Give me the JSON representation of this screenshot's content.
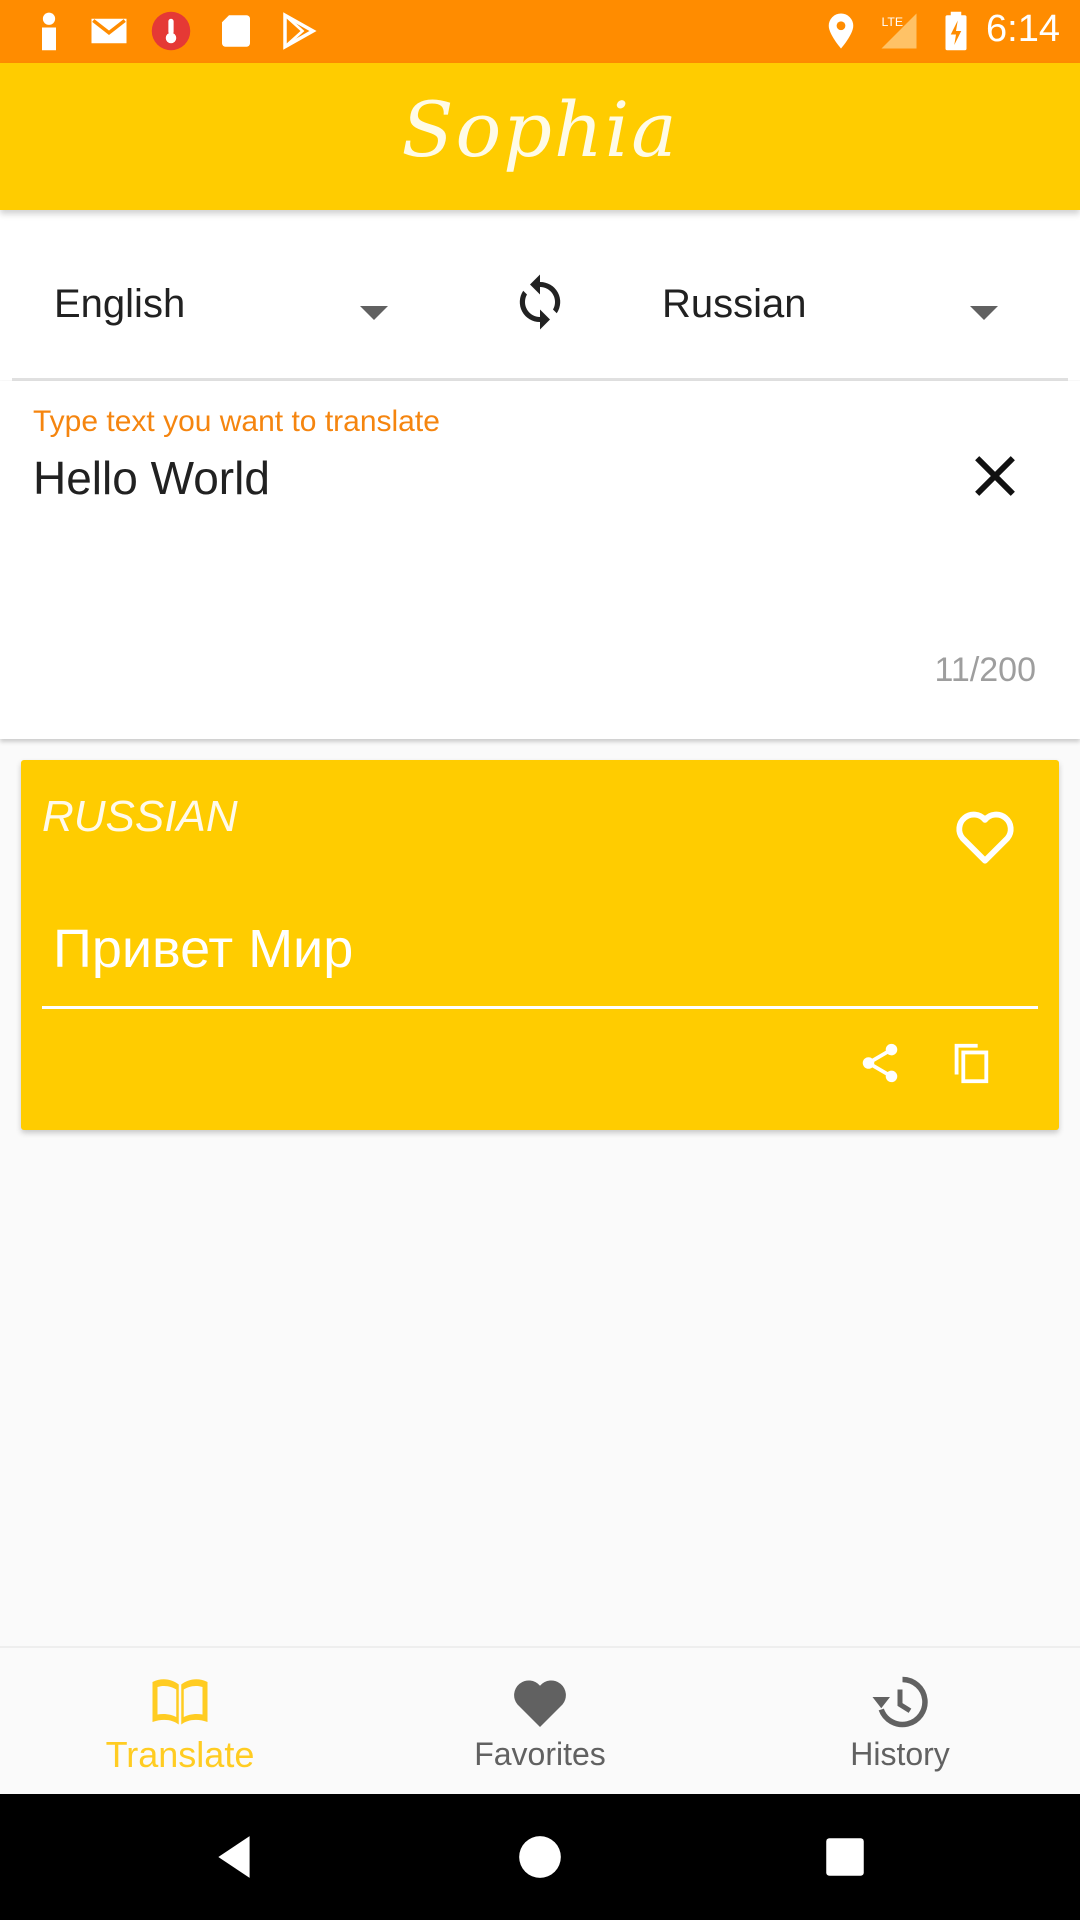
{
  "status_bar": {
    "time": "6:14",
    "network": "LTE",
    "left_icons": [
      "person-icon",
      "gmail-icon",
      "thermometer-icon",
      "sd-card-icon",
      "play-store-icon"
    ],
    "right_icons": [
      "location-icon",
      "signal-icon",
      "battery-charging-icon"
    ],
    "color": "#ff8c00"
  },
  "app_bar": {
    "title": "Sophia",
    "color": "#ffcc00"
  },
  "languages": {
    "source": "English",
    "target": "Russian"
  },
  "input": {
    "hint": "Type text you want to translate",
    "value": "Hello World",
    "counter": "11/200"
  },
  "result": {
    "language": "RUSSIAN",
    "text": "Привет Мир",
    "icons": [
      "heart-outline-icon",
      "share-icon",
      "copy-icon"
    ]
  },
  "bottom_nav": {
    "items": [
      {
        "label": "Translate",
        "icon": "book-icon",
        "active": true
      },
      {
        "label": "Favorites",
        "icon": "heart-icon",
        "active": false
      },
      {
        "label": "History",
        "icon": "history-icon",
        "active": false
      }
    ],
    "active_color": "#ffcc22"
  }
}
